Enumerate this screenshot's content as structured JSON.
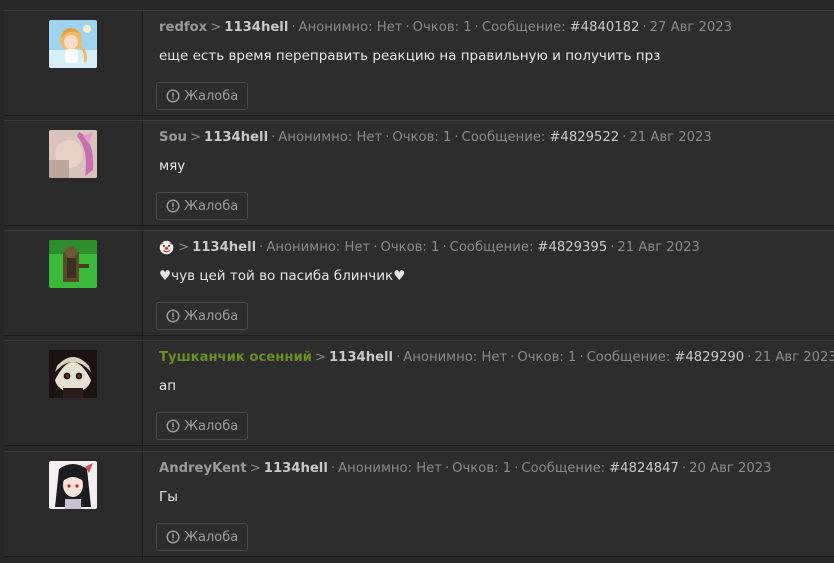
{
  "posts": [
    {
      "author": "redfox",
      "author_special": false,
      "clown": false,
      "arrow": ">",
      "target": "1134hell",
      "anon_label": "Анонимно: Нет",
      "points_label": "Очков: 1",
      "message_label": "Сообщение:",
      "message_num": "#4840182",
      "date": "27 Авг 2023",
      "text": "еще есть время переправить реакцию на правильную и получить прз",
      "report_label": "Жалоба"
    },
    {
      "author": "Sou",
      "author_special": false,
      "clown": false,
      "arrow": ">",
      "target": "1134hell",
      "anon_label": "Анонимно: Нет",
      "points_label": "Очков: 1",
      "message_label": "Сообщение:",
      "message_num": "#4829522",
      "date": "21 Авг 2023",
      "text": "мяу",
      "report_label": "Жалоба"
    },
    {
      "author": "",
      "author_special": false,
      "clown": true,
      "arrow": ">",
      "target": "1134hell",
      "anon_label": "Анонимно: Нет",
      "points_label": "Очков: 1",
      "message_label": "Сообщение:",
      "message_num": "#4829395",
      "date": "21 Авг 2023",
      "text": "♥чув цей той во пасиба блинчик♥",
      "report_label": "Жалоба"
    },
    {
      "author": "Тушканчик осенний",
      "author_special": true,
      "clown": false,
      "arrow": ">",
      "target": "1134hell",
      "anon_label": "Анонимно: Нет",
      "points_label": "Очков: 1",
      "message_label": "Сообщение:",
      "message_num": "#4829290",
      "date": "21 Авг 2023",
      "text": "ап",
      "report_label": "Жалоба"
    },
    {
      "author": "AndreyKent",
      "author_special": false,
      "clown": false,
      "arrow": ">",
      "target": "1134hell",
      "anon_label": "Анонимно: Нет",
      "points_label": "Очков: 1",
      "message_label": "Сообщение:",
      "message_num": "#4824847",
      "date": "20 Авг 2023",
      "text": "Гы",
      "report_label": "Жалоба"
    }
  ],
  "colors": {
    "background": "#272727",
    "special_author": "#6b8e23",
    "text": "#e6e6e6",
    "muted": "#8a8a8a"
  },
  "icons": {
    "report": "exclamation-circle-icon",
    "clown": "clown-face-icon"
  }
}
